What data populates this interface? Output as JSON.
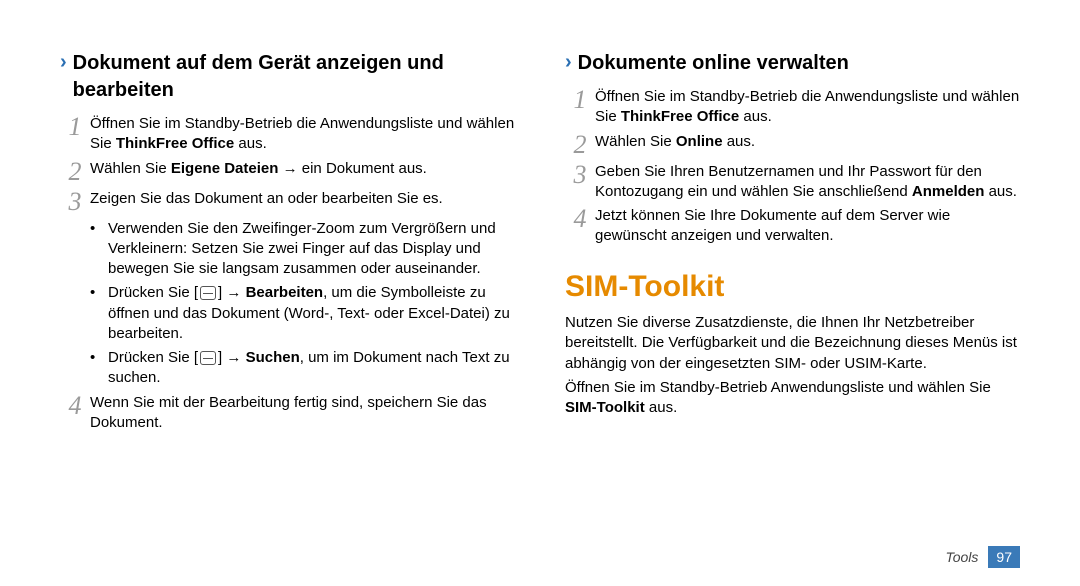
{
  "left": {
    "heading": "Dokument auf dem Gerät anzeigen und bearbeiten",
    "steps": {
      "s1a": "Öffnen Sie im Standby-Betrieb die Anwendungsliste und wählen Sie ",
      "s1b": "ThinkFree Office",
      "s1c": " aus.",
      "s2a": "Wählen Sie ",
      "s2b": "Eigene Dateien",
      "s2c": " → ein Dokument aus.",
      "s3": "Zeigen Sie das Dokument an oder bearbeiten Sie es.",
      "b1": "Verwenden Sie den Zweifinger-Zoom zum Vergrößern und Verkleinern: Setzen Sie zwei Finger auf das Display und bewegen Sie sie langsam zusammen oder auseinander.",
      "b2a": "Drücken Sie [",
      "b2b": "] → ",
      "b2c": "Bearbeiten",
      "b2d": ", um die Symbolleiste zu öffnen und das Dokument (Word-, Text- oder Excel-Datei) zu bearbeiten.",
      "b3a": "Drücken Sie [",
      "b3b": "] → ",
      "b3c": "Suchen",
      "b3d": ", um im Dokument nach Text zu suchen.",
      "s4": "Wenn Sie mit der Bearbeitung fertig sind, speichern Sie das Dokument."
    }
  },
  "right": {
    "heading": "Dokumente online verwalten",
    "steps": {
      "s1a": "Öffnen Sie im Standby-Betrieb die Anwendungsliste und wählen Sie ",
      "s1b": "ThinkFree Office",
      "s1c": " aus.",
      "s2a": "Wählen Sie ",
      "s2b": "Online",
      "s2c": " aus.",
      "s3a": "Geben Sie Ihren Benutzernamen und Ihr Passwort für den Kontozugang ein und wählen Sie anschließend ",
      "s3b": "Anmelden",
      "s3c": " aus.",
      "s4": "Jetzt können Sie Ihre Dokumente auf dem Server wie gewünscht anzeigen und verwalten."
    },
    "title2": "SIM-Toolkit",
    "p1": "Nutzen Sie diverse Zusatzdienste, die Ihnen Ihr Netzbetreiber bereitstellt. Die Verfügbarkeit und die Bezeichnung dieses Menüs ist abhängig von der eingesetzten SIM- oder USIM-Karte.",
    "p2a": "Öffnen Sie im Standby-Betrieb Anwendungsliste und wählen Sie ",
    "p2b": "SIM-Toolkit",
    "p2c": " aus."
  },
  "footer": {
    "label": "Tools",
    "page": "97"
  },
  "nums": {
    "n1": "1",
    "n2": "2",
    "n3": "3",
    "n4": "4"
  }
}
